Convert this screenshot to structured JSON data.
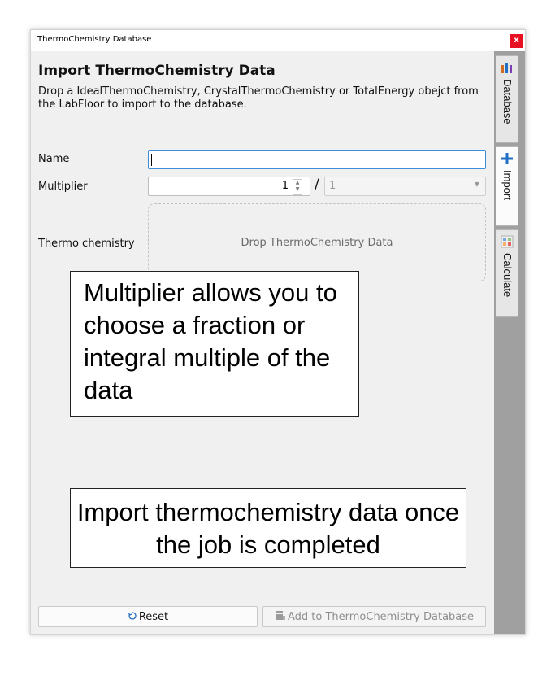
{
  "window": {
    "title": "ThermoChemistry Database",
    "close_glyph": "x"
  },
  "form": {
    "heading": "Import ThermoChemistry Data",
    "description": "Drop a IdealThermoChemistry, CrystalThermoChemistry or TotalEnergy obejct from the LabFloor to import to the database.",
    "name_label": "Name",
    "name_value": "",
    "multiplier_label": "Multiplier",
    "multiplier_value": "1",
    "multiplier_separator": "/",
    "divisor_value": "1",
    "thermo_label": "Thermo chemistry",
    "drop_text": "Drop ThermoChemistry Data"
  },
  "buttons": {
    "reset_label": "Reset",
    "reset_icon": "refresh-icon",
    "add_label": "Add to ThermoChemistry Database",
    "add_icon": "database-icon",
    "add_enabled": false
  },
  "sidebar": {
    "tabs": [
      {
        "label": "Database",
        "icon": "database-bars-icon",
        "active": false
      },
      {
        "label": "Import",
        "icon": "plus-icon",
        "active": true
      },
      {
        "label": "Calculate",
        "icon": "calculator-icon",
        "active": false
      }
    ]
  },
  "annotations": {
    "note1": "Multiplier allows you to choose a fraction or integral multiple of the data",
    "note2": "Import thermochemistry data once the job is completed"
  },
  "colors": {
    "close": "#e81123",
    "input_focus": "#3b8fd8",
    "import_plus": "#1f6fc5"
  }
}
